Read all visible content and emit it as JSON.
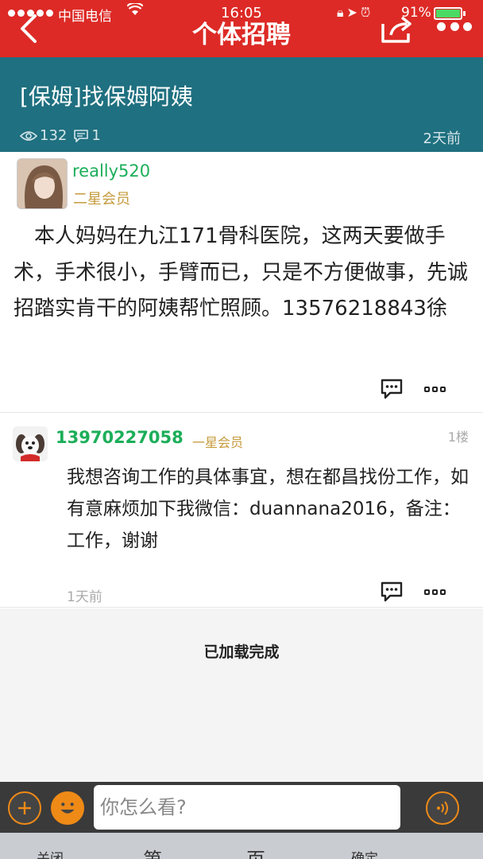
{
  "status_bar": {
    "carrier": "中国电信",
    "time": "16:05",
    "battery": "91%",
    "battery_level": 0.91
  },
  "nav": {
    "title": "个体招聘"
  },
  "post": {
    "title": "[保姆]找保姆阿姨",
    "views": "132",
    "comments": "1",
    "time": "2天前"
  },
  "op": {
    "username": "really520",
    "rank": "二星会员",
    "body": "本人妈妈在九江171骨科医院，这两天要做手术，手术很小，手臂而已，只是不方便做事，先诚招踏实肯干的阿姨帮忙照顾。13576218843徐"
  },
  "reply": {
    "username": "13970227058",
    "rank": "一星会员",
    "floor": "1楼",
    "body": "我想咨询工作的具体事宜，想在都昌找份工作，如有意麻烦加下我微信：duannana2016，备注：工作，谢谢",
    "time": "1天前"
  },
  "list": {
    "loaded_text": "已加载完成"
  },
  "input": {
    "placeholder": "你怎么看?"
  },
  "keyboard_strip": {
    "items": [
      "关闭",
      "第",
      "页",
      "确定"
    ]
  },
  "colors": {
    "header_red": "#dd2a26",
    "post_head_teal": "#1f7080",
    "username_green": "#1bae59",
    "rank_gold": "#c59a3b",
    "accent_orange": "#ef8a17"
  }
}
